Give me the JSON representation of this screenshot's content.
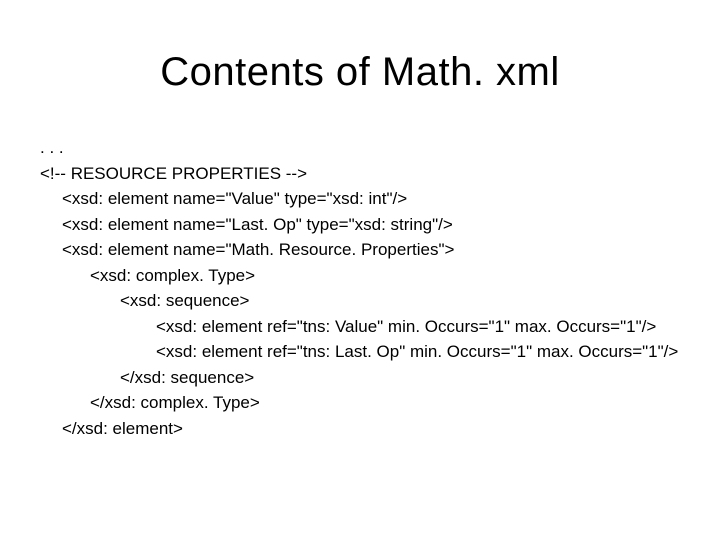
{
  "title": "Contents of Math. xml",
  "lines": [
    {
      "indent": "l0",
      "text": ". . ."
    },
    {
      "indent": "l0",
      "text": "<!-- RESOURCE PROPERTIES -->"
    },
    {
      "indent": "l1",
      "text": "<xsd: element name=\"Value\" type=\"xsd: int\"/>"
    },
    {
      "indent": "l1",
      "text": "<xsd: element name=\"Last. Op\" type=\"xsd: string\"/>"
    },
    {
      "indent": "l1",
      "text": "<xsd: element name=\"Math. Resource. Properties\">"
    },
    {
      "indent": "l2",
      "text": "<xsd: complex. Type>"
    },
    {
      "indent": "l3",
      "text": "<xsd: sequence>"
    },
    {
      "indent": "l4",
      "text": "<xsd: element ref=\"tns: Value\" min. Occurs=\"1\" max. Occurs=\"1\"/>"
    },
    {
      "indent": "l4",
      "text": "<xsd: element ref=\"tns: Last. Op\" min. Occurs=\"1\" max. Occurs=\"1\"/>"
    },
    {
      "indent": "l3",
      "text": "</xsd: sequence>"
    },
    {
      "indent": "l2",
      "text": "</xsd: complex. Type>"
    },
    {
      "indent": "l1",
      "text": "</xsd: element>"
    }
  ]
}
